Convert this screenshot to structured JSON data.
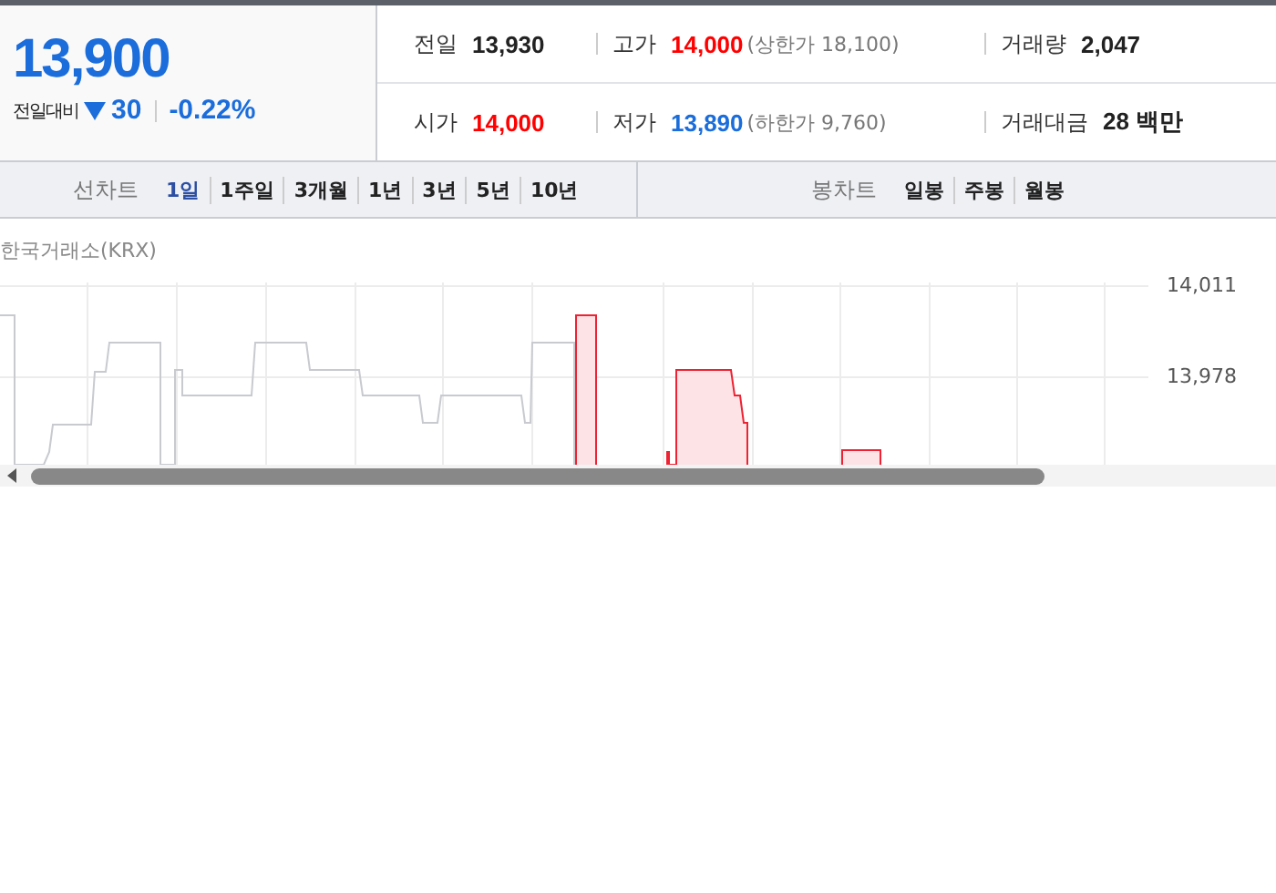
{
  "quote": {
    "price": "13,900",
    "change_label": "전일대비",
    "falling": true,
    "change": "30",
    "percent": "-0.22%"
  },
  "stats": [
    [
      {
        "label": "전일",
        "value": "13,930",
        "color": "#222222"
      },
      {
        "label": "고가",
        "value": "14,000",
        "color": "#ff0000",
        "note": "(상한가 18,100)"
      },
      {
        "label": "거래량",
        "value": "2,047",
        "color": "#222222"
      }
    ],
    [
      {
        "label": "시가",
        "value": "14,000",
        "color": "#ff0000"
      },
      {
        "label": "저가",
        "value": "13,890",
        "color": "#1a6ddb",
        "note": "(하한가 9,760)"
      },
      {
        "label": "거래대금",
        "value": "28 백만",
        "color": "#222222"
      }
    ]
  ],
  "line_chart_nav": {
    "label": "선차트",
    "periods": [
      {
        "label": "1일",
        "selected": true
      },
      {
        "label": "1주일",
        "selected": false
      },
      {
        "label": "3개월",
        "selected": false
      },
      {
        "label": "1년",
        "selected": false
      },
      {
        "label": "3년",
        "selected": false
      },
      {
        "label": "5년",
        "selected": false
      },
      {
        "label": "10년",
        "selected": false
      }
    ]
  },
  "candle_chart_nav": {
    "label": "봉차트",
    "periods": [
      {
        "label": "일봉",
        "selected": false
      },
      {
        "label": "주봉",
        "selected": false
      },
      {
        "label": "월봉",
        "selected": false
      }
    ]
  },
  "chart": {
    "source": "한국거래소(KRX)",
    "y_labels": [
      "14,011",
      "13,978"
    ]
  }
}
